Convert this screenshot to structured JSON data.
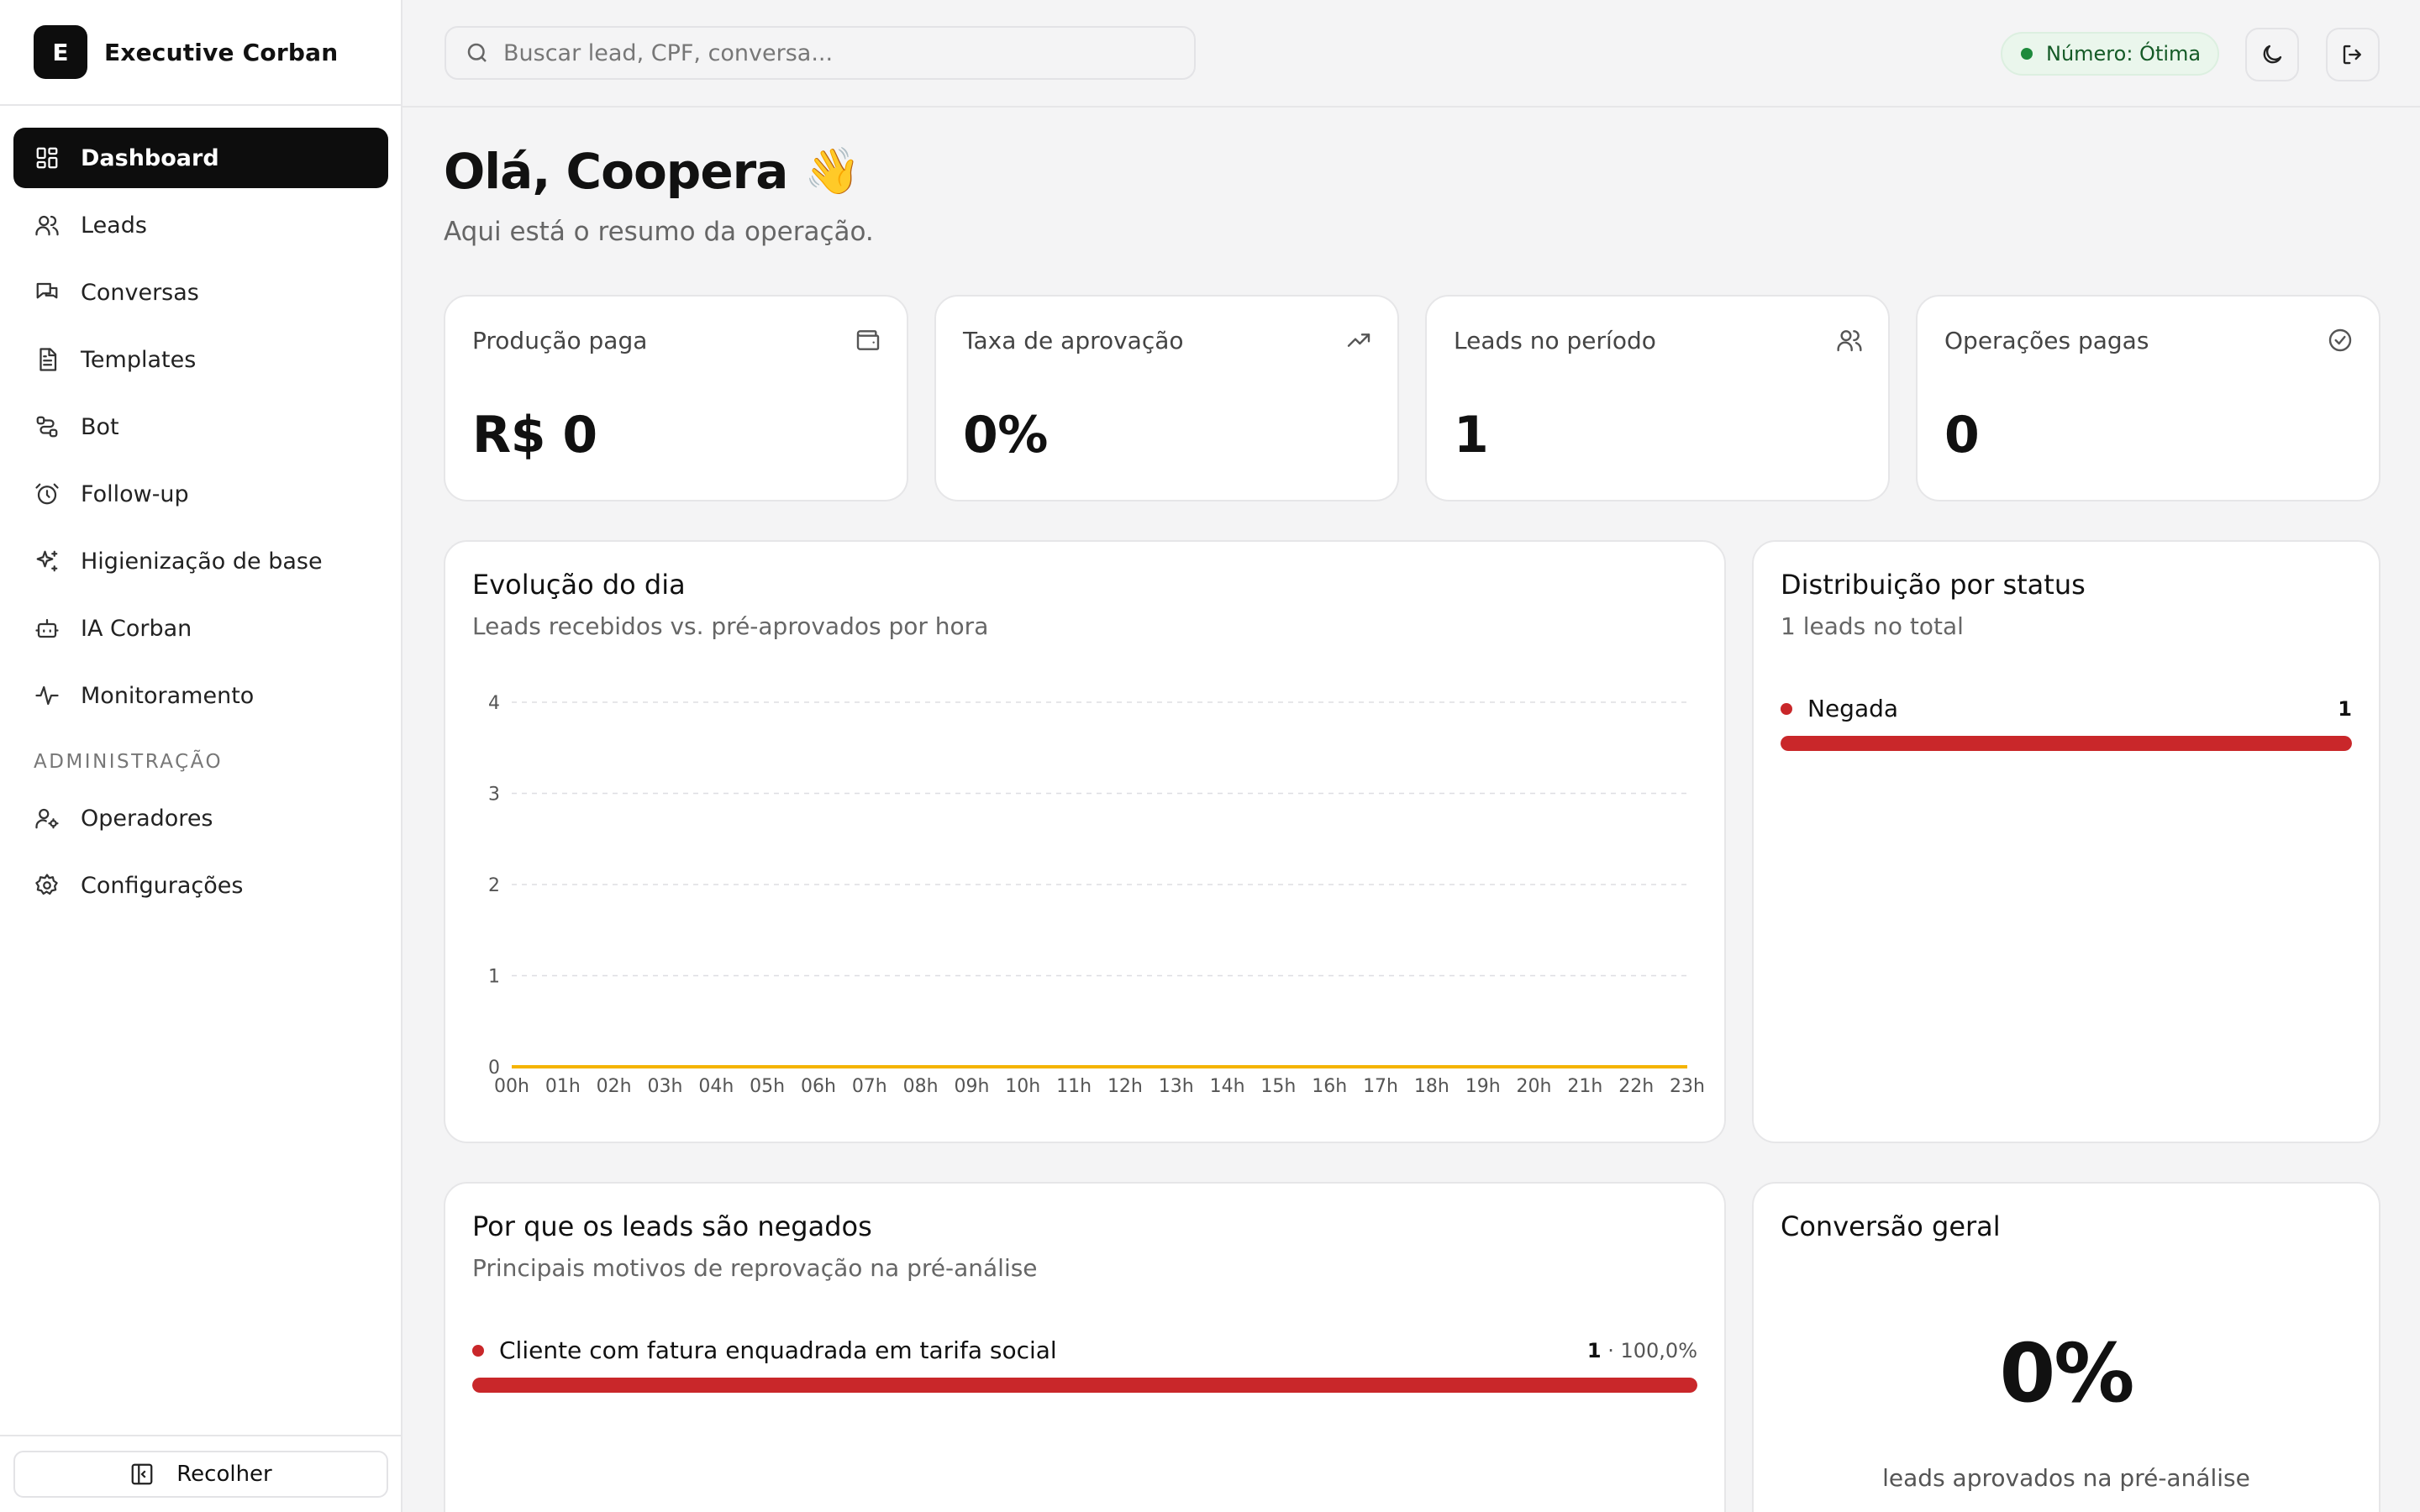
{
  "brand": {
    "initial": "E",
    "name": "Executive Corban"
  },
  "nav": {
    "items": [
      {
        "label": "Dashboard",
        "icon": "dashboard-icon",
        "active": true
      },
      {
        "label": "Leads",
        "icon": "users-icon"
      },
      {
        "label": "Conversas",
        "icon": "chat-icon"
      },
      {
        "label": "Templates",
        "icon": "document-icon"
      },
      {
        "label": "Bot",
        "icon": "workflow-icon"
      },
      {
        "label": "Follow-up",
        "icon": "alarm-clock-icon"
      },
      {
        "label": "Higienização de base",
        "icon": "sparkles-icon"
      },
      {
        "label": "IA Corban",
        "icon": "robot-icon"
      },
      {
        "label": "Monitoramento",
        "icon": "activity-icon"
      }
    ],
    "section_admin": "ADMINISTRAÇÃO",
    "admin_items": [
      {
        "label": "Operadores",
        "icon": "user-cog-icon"
      },
      {
        "label": "Configurações",
        "icon": "gear-icon"
      }
    ],
    "collapse_label": "Recolher"
  },
  "topbar": {
    "search_placeholder": "Buscar lead, CPF, conversa...",
    "status_label": "Número: Ótima",
    "status_color": "#1e8a3c"
  },
  "header": {
    "greeting": "Olá, Coopera",
    "wave": "👋",
    "subtitle": "Aqui está o resumo da operação."
  },
  "kpis": [
    {
      "label": "Produção paga",
      "value": "R$ 0",
      "icon": "wallet-icon"
    },
    {
      "label": "Taxa de aprovação",
      "value": "0%",
      "icon": "trending-up-icon"
    },
    {
      "label": "Leads no período",
      "value": "1",
      "icon": "users-icon"
    },
    {
      "label": "Operações pagas",
      "value": "0",
      "icon": "check-circle-icon"
    }
  ],
  "evolution": {
    "title": "Evolução do dia",
    "subtitle": "Leads recebidos vs. pré-aprovados por hora"
  },
  "chart_data": {
    "type": "line",
    "x": [
      "00h",
      "01h",
      "02h",
      "03h",
      "04h",
      "05h",
      "06h",
      "07h",
      "08h",
      "09h",
      "10h",
      "11h",
      "12h",
      "13h",
      "14h",
      "15h",
      "16h",
      "17h",
      "18h",
      "19h",
      "20h",
      "21h",
      "22h",
      "23h"
    ],
    "series": [
      {
        "values": [
          0,
          0,
          0,
          0,
          0,
          0,
          0,
          0,
          0,
          0,
          0,
          0,
          0,
          0,
          0,
          0,
          0,
          0,
          0,
          0,
          0,
          0,
          0,
          0
        ],
        "color": "#f5b400"
      }
    ],
    "yticks": [
      "0",
      "1",
      "2",
      "3",
      "4"
    ],
    "ylim": [
      0,
      4
    ],
    "grid": true
  },
  "distribution": {
    "title": "Distribuição por status",
    "subtitle": "1 leads no total",
    "items": [
      {
        "label": "Negada",
        "value": "1",
        "fraction": 1.0,
        "color": "#c9272a"
      }
    ]
  },
  "denials": {
    "title": "Por que os leads são negados",
    "subtitle": "Principais motivos de reprovação na pré-análise",
    "items": [
      {
        "label": "Cliente com fatura enquadrada em tarifa social",
        "count": "1",
        "pct": " · 100,0%",
        "fraction": 1.0,
        "color": "#c9272a"
      }
    ]
  },
  "conversion": {
    "title": "Conversão geral",
    "value": "0%",
    "caption": "leads aprovados na pré-análise"
  }
}
